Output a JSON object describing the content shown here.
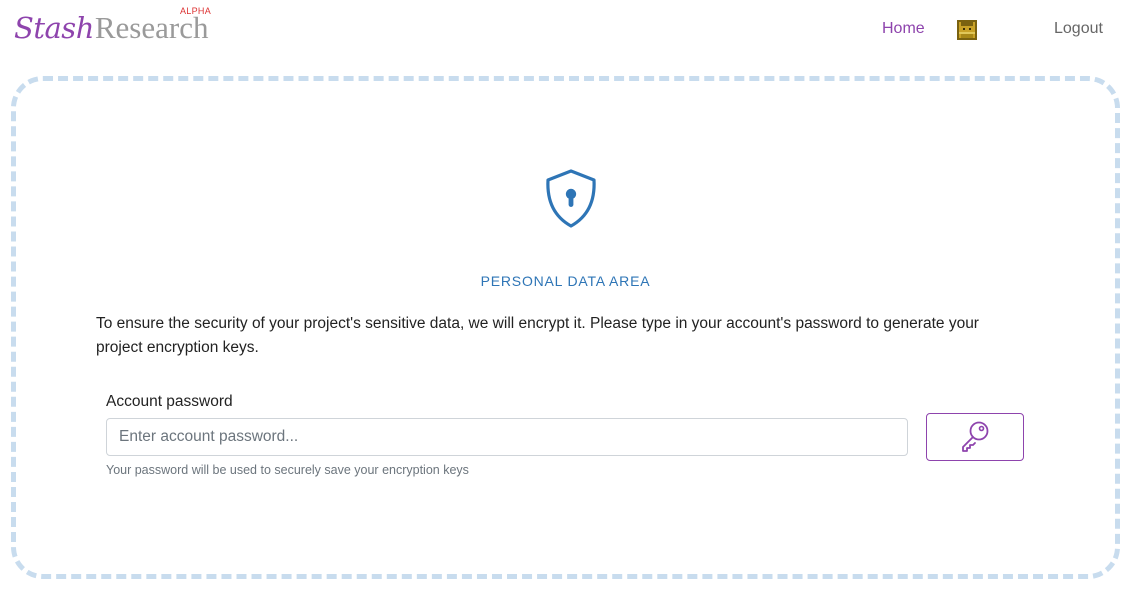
{
  "header": {
    "brand_stash": "Stash",
    "brand_research": "Research",
    "brand_badge": "ALPHA",
    "nav_home": "Home",
    "nav_logout": "Logout",
    "avatar_icon": "pixel-avatar-icon"
  },
  "main": {
    "icon": "shield-lock-icon",
    "title": "PERSONAL DATA AREA",
    "description": "To ensure the security of your project's sensitive data, we will encrypt it. Please type in your account's password to generate your project encryption keys.",
    "password_label": "Account password",
    "password_placeholder": "Enter account password...",
    "password_value": "",
    "password_help": "Your password will be used to securely save your encryption keys",
    "submit_icon": "key-icon"
  },
  "colors": {
    "brand_purple": "#8e44ad",
    "brand_gray": "#9a9a9a",
    "accent_blue": "#2e75b6",
    "dashed_border": "#c8dcee",
    "alpha_red": "#dd3333"
  }
}
